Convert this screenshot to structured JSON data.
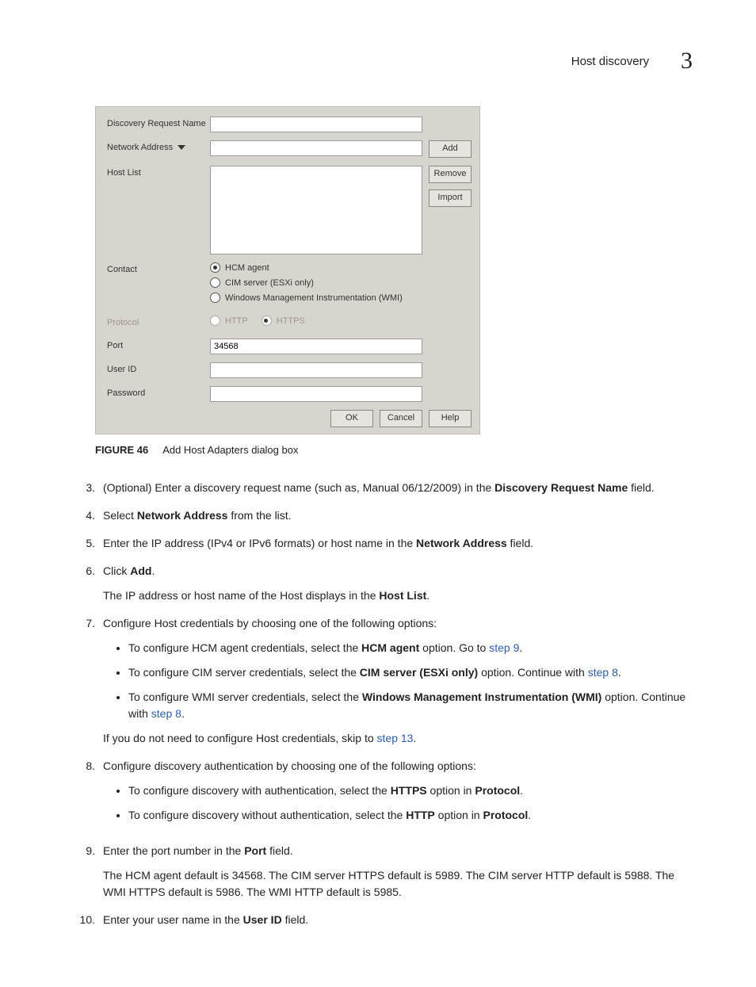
{
  "header": {
    "section": "Host discovery",
    "chapter": "3"
  },
  "dialog": {
    "labels": {
      "name": "Discovery Request Name",
      "addr": "Network Address",
      "hostlist": "Host List",
      "contact": "Contact",
      "protocol": "Protocol",
      "port": "Port",
      "userid": "User ID",
      "password": "Password"
    },
    "contact_options": {
      "hcm": "HCM agent",
      "cim": "CIM server (ESXi only)",
      "wmi": "Windows Management Instrumentation (WMI)"
    },
    "protocol_options": {
      "http": "HTTP",
      "https": "HTTPS"
    },
    "port_value": "34568",
    "buttons": {
      "add": "Add",
      "remove": "Remove",
      "import": "Import",
      "ok": "OK",
      "cancel": "Cancel",
      "help": "Help"
    }
  },
  "caption": {
    "fig": "FIGURE 46",
    "text": "Add Host Adapters dialog box"
  },
  "step3": {
    "a": "(Optional) Enter a discovery request name (such as, Manual 06/12/2009) in the ",
    "b": "Discovery Request Name",
    "c": " field."
  },
  "step4": {
    "a": "Select ",
    "b": "Network Address",
    "c": " from the list."
  },
  "step5": {
    "a": "Enter the IP address (IPv4 or IPv6 formats) or host name in the ",
    "b": "Network Address",
    "c": " field."
  },
  "step6": {
    "a": "Click ",
    "b": "Add",
    "c": ".",
    "p2a": "The IP address or host name of the Host displays in the ",
    "p2b": "Host List",
    "p2c": "."
  },
  "step7": {
    "intro": "Configure Host credentials by choosing one of the following options:",
    "b1a": "To configure HCM agent credentials, select the ",
    "b1b": "HCM agent",
    "b1c": " option. Go to ",
    "b1link": "step 9",
    "b1d": ".",
    "b2a": "To configure CIM server credentials, select the ",
    "b2b": "CIM server (ESXi only)",
    "b2c": " option. Continue with ",
    "b2link": "step 8",
    "b2d": ".",
    "b3a": "To configure WMI server credentials, select the ",
    "b3b": "Windows Management Instrumentation (WMI)",
    "b3c": " option. Continue with ",
    "b3link": "step 8",
    "b3d": ".",
    "tail_a": "If you do not need to configure Host credentials, skip to ",
    "tail_link": "step 13",
    "tail_b": "."
  },
  "step8": {
    "intro": "Configure discovery authentication by choosing one of the following options:",
    "b1a": "To configure discovery with authentication, select the ",
    "b1b": "HTTPS",
    "b1c": " option in ",
    "b1d": "Protocol",
    "b1e": ".",
    "b2a": "To configure discovery without authentication, select the ",
    "b2b": "HTTP",
    "b2c": " option in ",
    "b2d": "Protocol",
    "b2e": "."
  },
  "step9": {
    "a": "Enter the port number in the ",
    "b": "Port",
    "c": " field.",
    "p2": "The HCM agent default is 34568. The CIM server HTTPS default is 5989. The CIM server HTTP default is 5988. The WMI HTTPS default is 5986. The WMI HTTP default is 5985."
  },
  "step10": {
    "a": "Enter your user name in the ",
    "b": "User ID",
    "c": " field."
  },
  "nums": {
    "n3": "3.",
    "n4": "4.",
    "n5": "5.",
    "n6": "6.",
    "n7": "7.",
    "n8": "8.",
    "n9": "9.",
    "n10": "10."
  }
}
